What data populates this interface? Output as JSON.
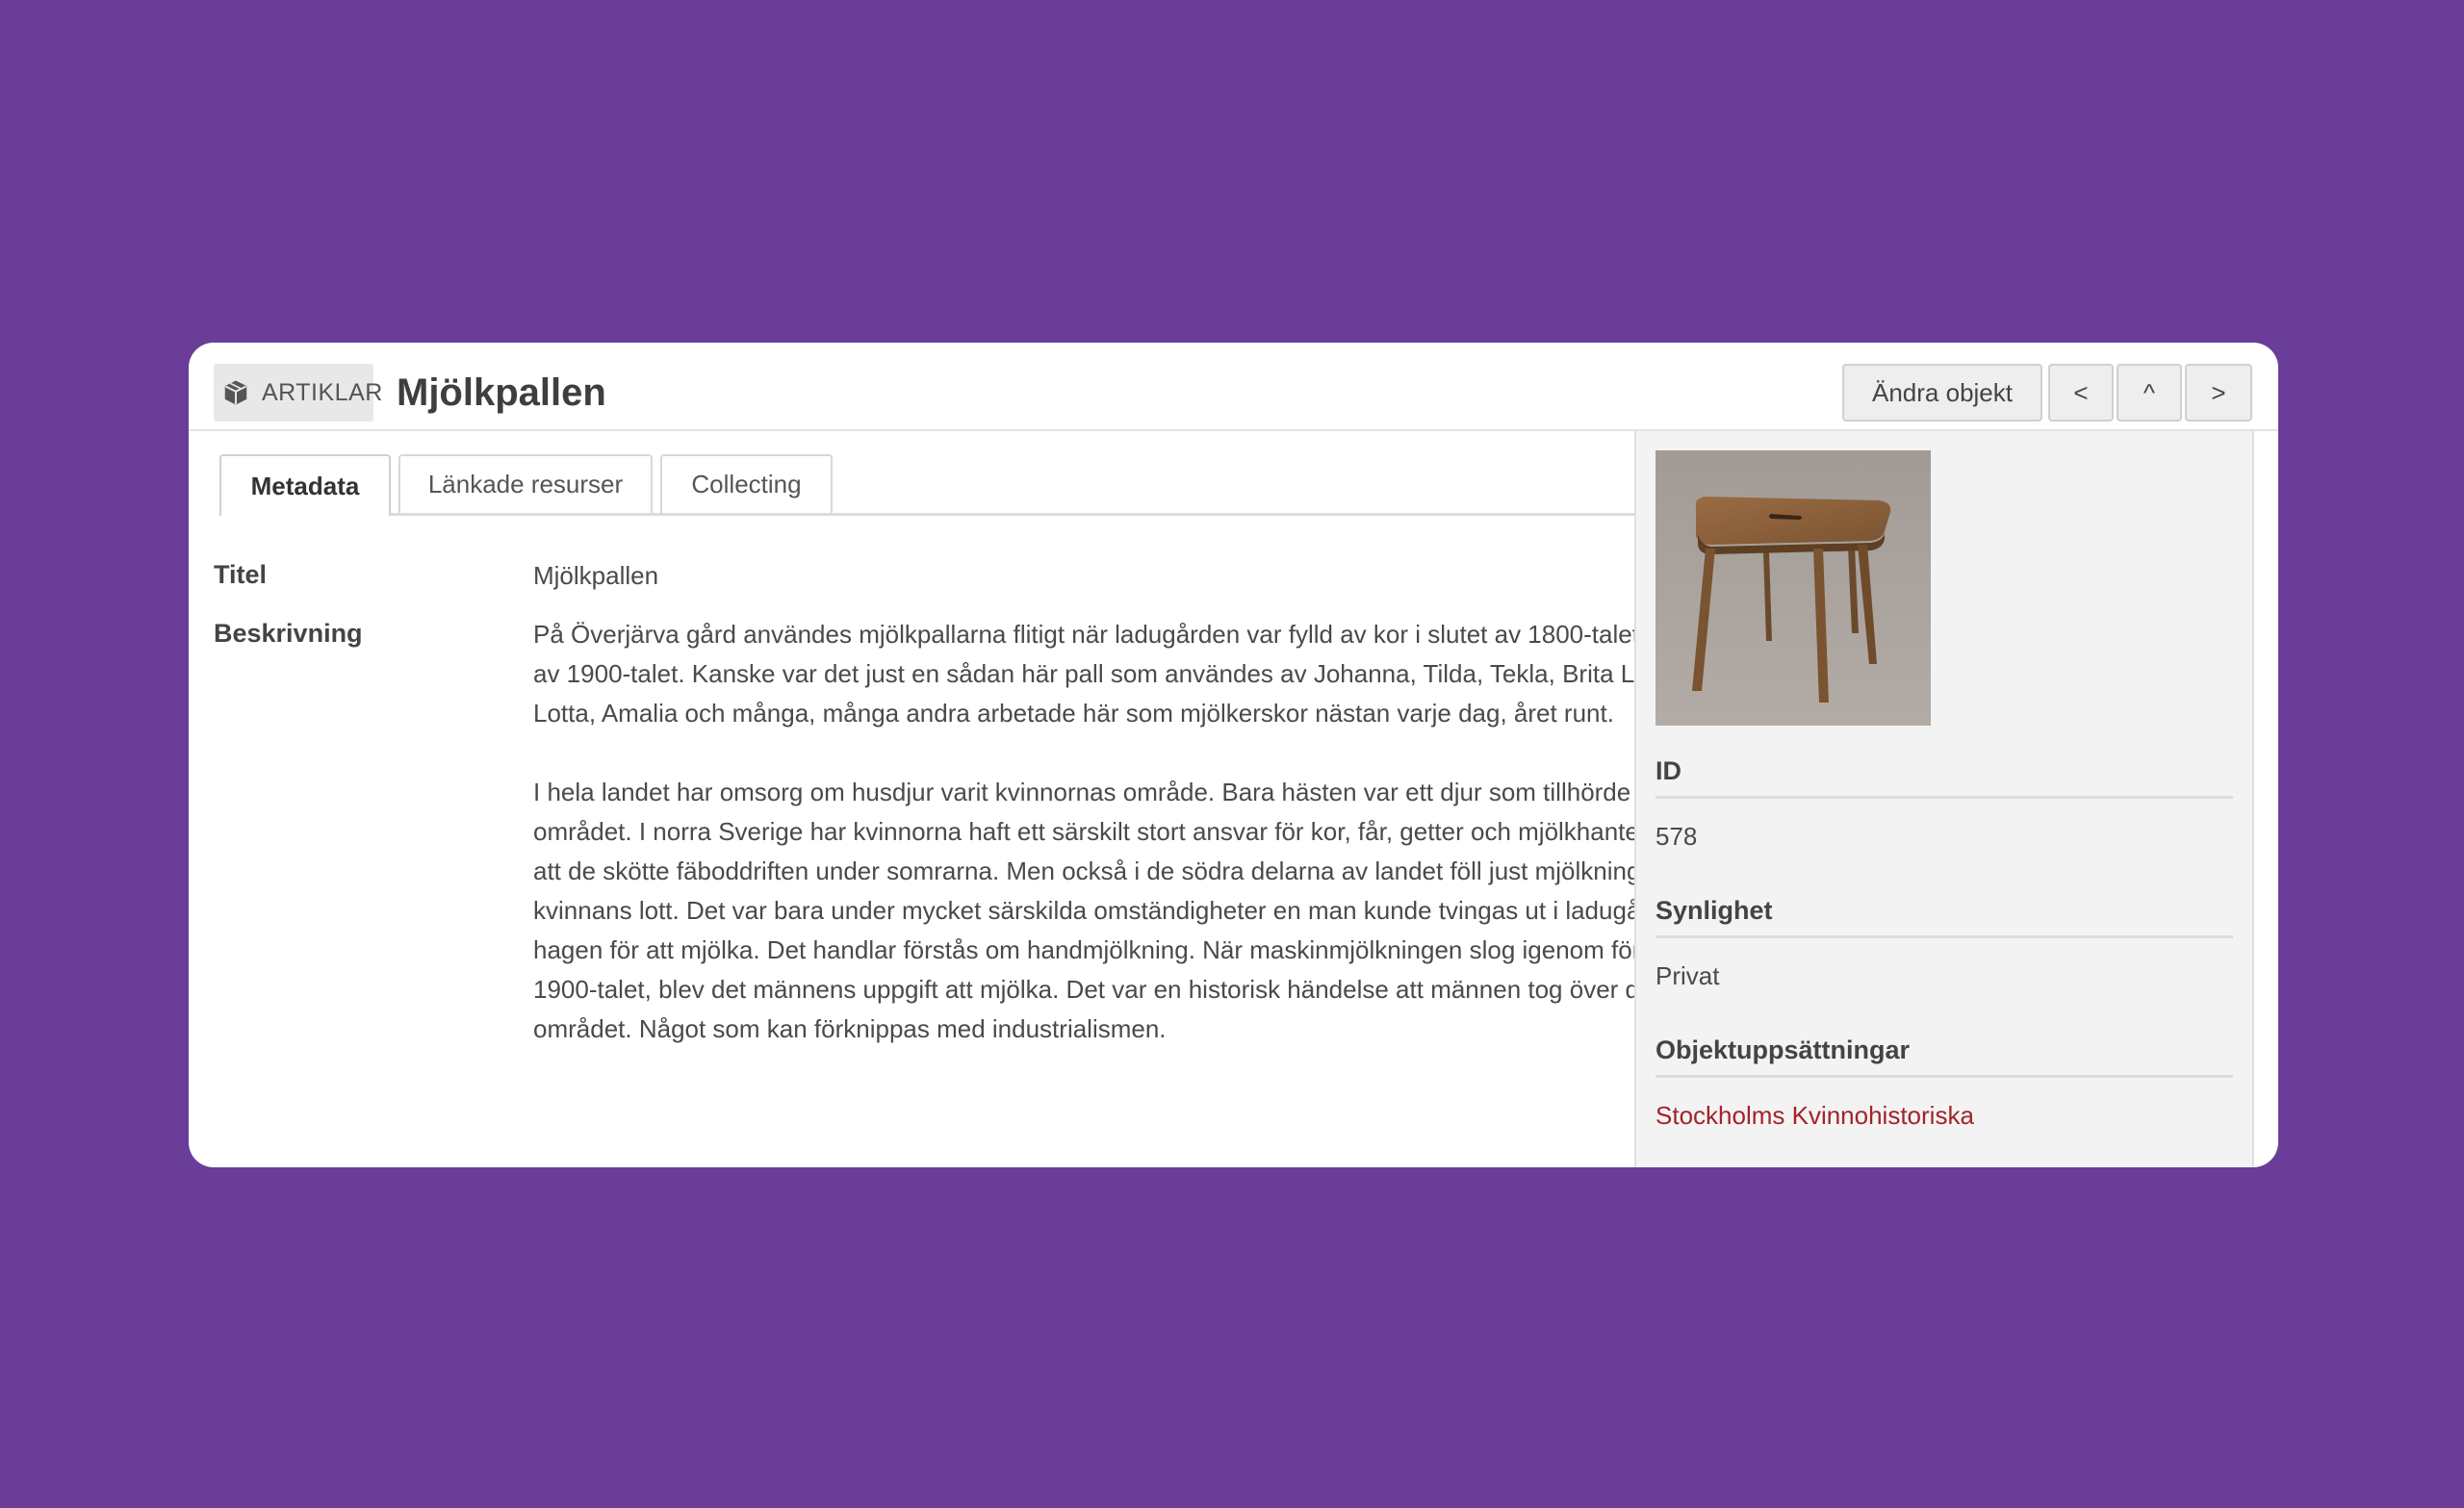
{
  "header": {
    "type_label": "ARTIKLAR",
    "title": "Mjölkpallen",
    "edit_button": "Ändra objekt",
    "prev_button": "<",
    "up_button": "^",
    "next_button": ">"
  },
  "tabs": [
    {
      "label": "Metadata",
      "active": true
    },
    {
      "label": "Länkade resurser",
      "active": false
    },
    {
      "label": "Collecting",
      "active": false
    }
  ],
  "metadata": {
    "title_label": "Titel",
    "title_value": "Mjölkpallen",
    "description_label": "Beskrivning",
    "description_paragraphs": [
      "På Överjärva gård användes mjölkpallarna flitigt när ladugården var fylld av kor i slutet av 1800-talet och början av 1900-talet. Kanske var det just en sådan här pall som användes av Johanna, Tilda, Tekla, Brita Lisa, Augusta, Lotta, Amalia och många, många andra arbetade här som mjölkerskor nästan varje dag, året runt.",
      "I hela landet har omsorg om husdjur varit kvinnornas område. Bara hästen var ett djur som tillhörde det manliga området. I norra Sverige har kvinnorna haft ett särskilt stort ansvar för kor, får, getter och mjölkhantering, genom att de skötte fäboddriften under somrarna. Men också i de södra delarna av landet föll just mjölkningen på kvinnans lott. Det var bara under mycket särskilda omständigheter en man kunde tvingas ut i ladugården eller hagen för att mjölka. Det handlar förstås om handmjölkning. När maskinmjölkningen slog igenom först i mitten av 1900-talet, blev det männens uppgift att mjölka. Det var en historisk händelse att männen tog över det viktiga området. Något som kan förknippas med industrialismen."
    ]
  },
  "sidebar": {
    "id_label": "ID",
    "id_value": "578",
    "visibility_label": "Synlighet",
    "visibility_value": "Privat",
    "sets_label": "Objektuppsättningar",
    "sets_value": "Stockholms Kvinnohistoriska"
  },
  "colors": {
    "background": "#6a3d98",
    "link": "#a3232a"
  }
}
